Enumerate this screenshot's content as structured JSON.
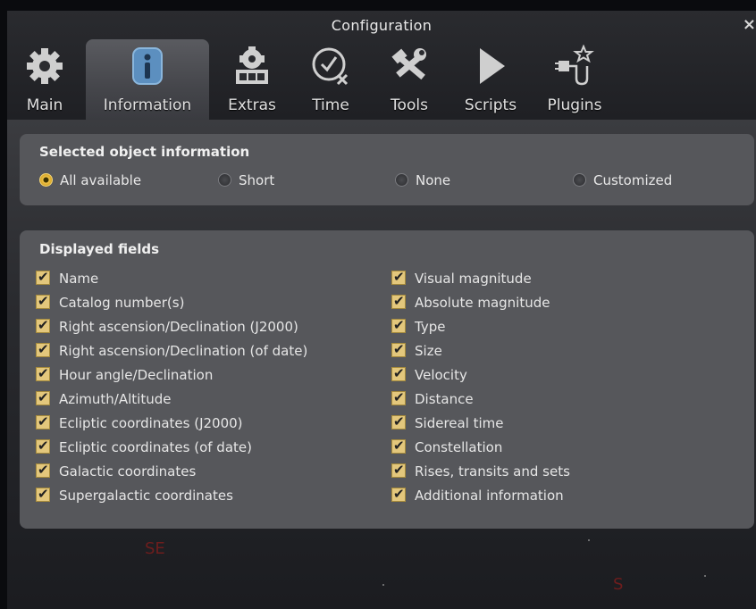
{
  "window": {
    "title": "Configuration",
    "close_symbol": "×"
  },
  "tabs": [
    {
      "label": "Main",
      "icon": "gear-icon"
    },
    {
      "label": "Information",
      "icon": "info-icon",
      "active": true
    },
    {
      "label": "Extras",
      "icon": "extras-icon"
    },
    {
      "label": "Time",
      "icon": "clock-icon"
    },
    {
      "label": "Tools",
      "icon": "tools-icon"
    },
    {
      "label": "Scripts",
      "icon": "play-icon"
    },
    {
      "label": "Plugins",
      "icon": "plug-icon"
    }
  ],
  "selected_object": {
    "title": "Selected object information",
    "options": [
      {
        "label": "All available",
        "checked": true
      },
      {
        "label": "Short",
        "checked": false
      },
      {
        "label": "None",
        "checked": false
      },
      {
        "label": "Customized",
        "checked": false
      }
    ]
  },
  "displayed_fields": {
    "title": "Displayed fields",
    "left": [
      "Name",
      "Catalog number(s)",
      "Right ascension/Declination (J2000)",
      "Right ascension/Declination (of date)",
      "Hour angle/Declination",
      "Azimuth/Altitude",
      "Ecliptic coordinates (J2000)",
      "Ecliptic coordinates (of date)",
      "Galactic coordinates",
      "Supergalactic coordinates"
    ],
    "right": [
      "Visual magnitude",
      "Absolute magnitude",
      "Type",
      "Size",
      "Velocity",
      "Distance",
      "Sidereal time",
      "Constellation",
      "Rises, transits and sets",
      "Additional information"
    ]
  },
  "background_labels": {
    "southeast": "SE",
    "south": "S"
  },
  "colors": {
    "accent": "#f0c44a",
    "checkbox": "#e3c77c",
    "panel": "#56575b"
  }
}
